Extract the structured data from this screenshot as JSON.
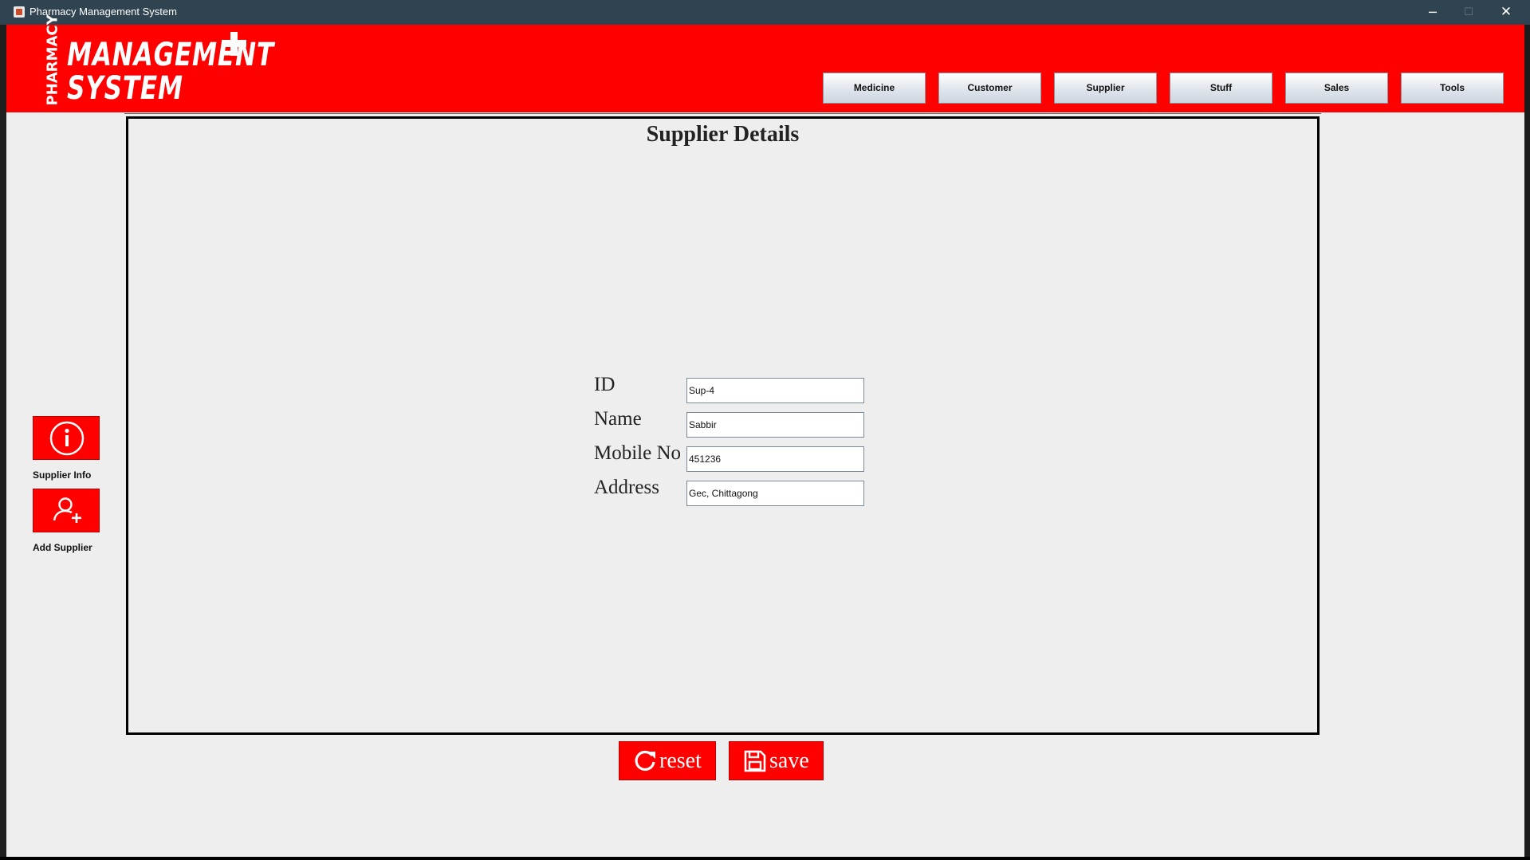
{
  "window": {
    "title": "Pharmacy Management System",
    "minimize_glyph": "─",
    "maximize_glyph": "☐",
    "close_glyph": "✕"
  },
  "logo": {
    "vertical_text": "PHARMACY",
    "line1": "MANAGEMENT",
    "line2": "SYSTEM"
  },
  "nav": {
    "items": [
      {
        "label": "Medicine"
      },
      {
        "label": "Customer"
      },
      {
        "label": "Supplier"
      },
      {
        "label": "Stuff"
      },
      {
        "label": "Sales"
      },
      {
        "label": "Tools"
      }
    ]
  },
  "sidebar": {
    "items": [
      {
        "label": "Supplier Info",
        "icon": "info-icon"
      },
      {
        "label": "Add Supplier",
        "icon": "add-user-icon"
      }
    ]
  },
  "panel": {
    "title": "Supplier Details",
    "fields": [
      {
        "label": "ID",
        "value": "Sup-4"
      },
      {
        "label": "Name",
        "value": "Sabbir"
      },
      {
        "label": "Mobile No",
        "value": "451236"
      },
      {
        "label": "Address",
        "value": "Gec, Chittagong"
      }
    ]
  },
  "actions": {
    "reset_label": "reset",
    "save_label": "save"
  },
  "colors": {
    "brand_red": "#ff0000",
    "titlebar": "#2f4350",
    "background": "#eeeeee"
  }
}
